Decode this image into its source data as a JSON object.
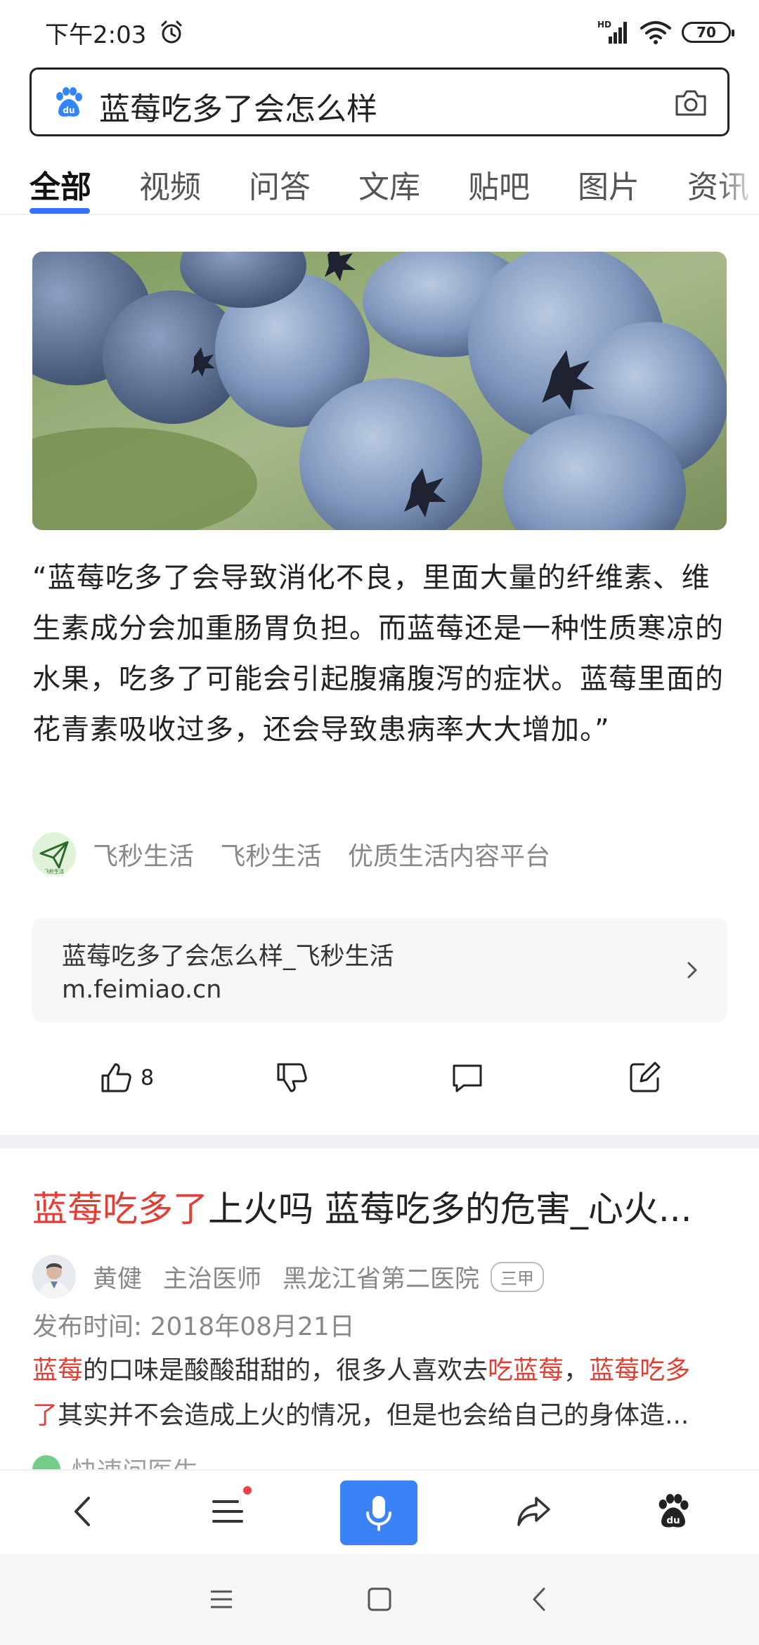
{
  "status_bar": {
    "time": "下午2:03",
    "network": "HD",
    "battery": "70"
  },
  "search": {
    "query": "蓝莓吃多了会怎么样"
  },
  "tabs": [
    {
      "label": "全部",
      "active": true
    },
    {
      "label": "视频"
    },
    {
      "label": "问答"
    },
    {
      "label": "文库"
    },
    {
      "label": "贴吧"
    },
    {
      "label": "图片"
    },
    {
      "label": "资讯"
    }
  ],
  "card1": {
    "quote": "“蓝莓吃多了会导致消化不良，里面大量的纤维素、维生素成分会加重肠胃负担。而蓝莓还是一种性质寒凉的水果，吃多了可能会引起腹痛腹泻的症状。蓝莓里面的花青素吸收过多，还会导致患病率大大增加。”",
    "source": {
      "name": "飞秒生活",
      "author": "飞秒生活",
      "description": "优质生活内容平台",
      "logo_text": "飞秒生活"
    },
    "link": {
      "title": "蓝莓吃多了会怎么样_飞秒生活",
      "url": "m.feimiao.cn"
    },
    "like_count": "8"
  },
  "card2": {
    "title_highlight": "蓝莓吃多了",
    "title_rest": "上火吗 蓝莓吃多的危害_心火...",
    "author": "黄健",
    "author_title": "主治医师",
    "hospital": "黑龙江省第二医院",
    "hospital_grade": "三甲",
    "publish_date": "发布时间: 2018年08月21日",
    "snippet": {
      "p1": "蓝莓",
      "p2": "的口味是酸酸甜甜的，很多人喜欢去",
      "p3": "吃蓝莓",
      "p4": "，",
      "p5": "蓝莓吃多",
      "p6": "了",
      "p7": "其实并不会造成上火的情况，但是也会给自己的身体造..."
    },
    "next_source": "快速问医生"
  },
  "colors": {
    "accent": "#3370ff",
    "highlight": "#e33e33",
    "mic_button": "#3b82f6"
  }
}
